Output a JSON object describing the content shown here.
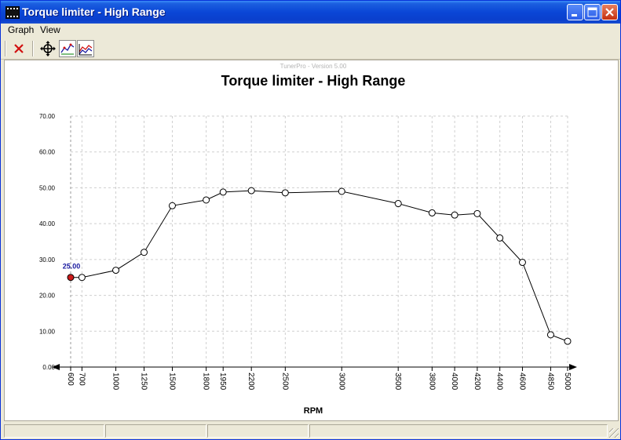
{
  "window": {
    "title": "Torque limiter - High Range"
  },
  "menu": {
    "items": [
      "Graph",
      "View"
    ]
  },
  "watermark": "TunerPro - Version 5.00",
  "selected_label": "25.00",
  "colors": {
    "line": "#000000",
    "marker_fill": "#ffffff",
    "selected_fill": "#cc1a1a",
    "selected_label": "#1a1aa0",
    "grid": "#cfcfcf",
    "close_icon": "#d11010"
  },
  "chart_data": {
    "type": "line",
    "title": "Torque limiter - High Range",
    "xlabel": "RPM",
    "ylabel": "",
    "x": [
      600,
      700,
      1000,
      1250,
      1500,
      1800,
      1950,
      2200,
      2500,
      3000,
      3500,
      3800,
      4000,
      4200,
      4400,
      4600,
      4850,
      5000
    ],
    "x_tick_labels": [
      "600",
      "700",
      "1000",
      "1250",
      "1500",
      "1800",
      "1950",
      "2200",
      "2500",
      "3000",
      "3500",
      "3800",
      "4000",
      "4200",
      "4400",
      "4600",
      "4850",
      "5000"
    ],
    "values": [
      25.0,
      25.0,
      27.0,
      32.0,
      45.0,
      46.6,
      48.8,
      49.2,
      48.6,
      49.0,
      45.6,
      43.0,
      42.4,
      42.8,
      36.0,
      29.2,
      9.0,
      7.2
    ],
    "y_tick_labels": [
      "0.00",
      "10.00",
      "20.00",
      "30.00",
      "40.00",
      "50.00",
      "60.00",
      "70.00"
    ],
    "y_ticks": [
      0,
      10,
      20,
      30,
      40,
      50,
      60,
      70
    ],
    "ylim": [
      0,
      70
    ],
    "xlim": [
      600,
      5000
    ],
    "grid": true,
    "selected_index": 0
  }
}
